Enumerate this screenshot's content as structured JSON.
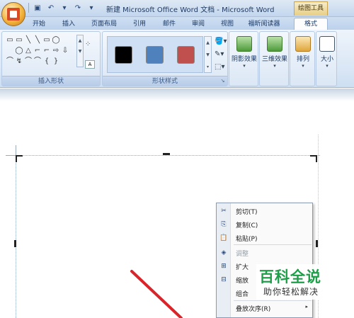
{
  "window": {
    "title": "新建 Microsoft Office Word 文档 - Microsoft Word",
    "context_tab_header": "绘图工具"
  },
  "quick_access": {
    "icons": [
      "save-icon",
      "undo-icon",
      "redo-icon"
    ]
  },
  "tabs": [
    {
      "label": "开始"
    },
    {
      "label": "插入"
    },
    {
      "label": "页面布局"
    },
    {
      "label": "引用"
    },
    {
      "label": "邮件"
    },
    {
      "label": "审阅"
    },
    {
      "label": "视图"
    },
    {
      "label": "福昕阅读器"
    },
    {
      "label": "格式",
      "active": true
    }
  ],
  "ribbon": {
    "insert_shapes": {
      "label": "插入形状",
      "shapes": [
        "▭",
        "▭",
        "╲",
        "╲",
        "▭",
        "◯",
        "",
        "",
        " ",
        "◯",
        "△",
        "⌐",
        "⌐",
        "⇨",
        "⇩",
        "",
        "⌒",
        "↯",
        "⌒",
        "⌒",
        "{",
        "}",
        "",
        ""
      ]
    },
    "shape_styles": {
      "label": "形状样式",
      "swatches": [
        "#000000",
        "#4f81bd",
        "#c0504d"
      ]
    },
    "shadow": {
      "label": "阴影效果"
    },
    "three_d": {
      "label": "三维效果"
    },
    "arrange": {
      "label": "排列"
    },
    "size": {
      "label": "大小"
    }
  },
  "context_menu": {
    "items": [
      {
        "label": "剪切(T)",
        "icon": "scissors-icon",
        "glyph": "✂",
        "disabled": false
      },
      {
        "label": "复制(C)",
        "icon": "copy-icon",
        "glyph": "⎘",
        "disabled": false
      },
      {
        "label": "粘贴(P)",
        "icon": "paste-icon",
        "glyph": "📋",
        "disabled": false
      },
      {
        "label": "调整",
        "icon": "adjust-icon",
        "glyph": "◈",
        "disabled": true
      },
      {
        "label": "扩大",
        "icon": "expand-icon",
        "glyph": "⊞",
        "disabled": false
      },
      {
        "label": "缩放",
        "icon": "scale-icon",
        "glyph": "⊟",
        "disabled": false
      },
      {
        "label": "组合",
        "icon": "group-icon",
        "glyph": "",
        "disabled": false
      },
      {
        "label": "叠放次序(R)",
        "icon": "order-icon",
        "glyph": "",
        "disabled": false,
        "submenu": true
      }
    ]
  },
  "watermark": {
    "title": "百科全说",
    "subtitle": "助你轻松解决"
  }
}
